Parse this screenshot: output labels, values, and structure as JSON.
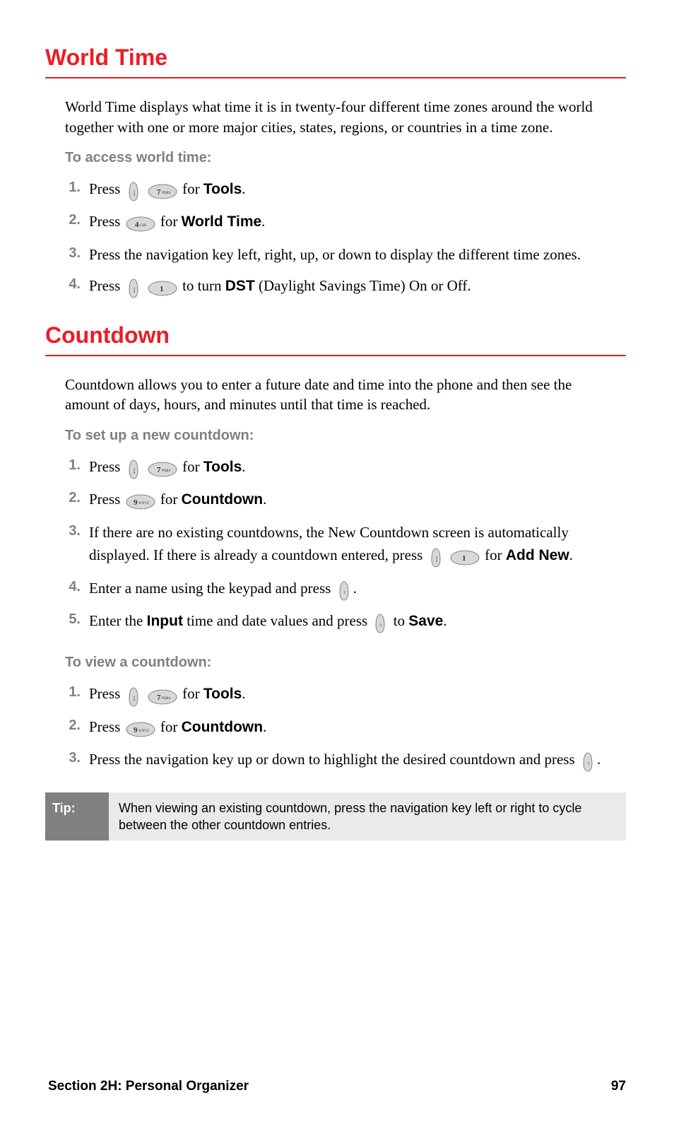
{
  "sections": [
    {
      "heading": "World Time",
      "intro": "World Time displays what time it is in twenty-four different time zones around the world together with one or more major cities, states, regions, or countries in a time zone.",
      "subhead": "To access world time:",
      "steps": [
        {
          "n": "1.",
          "pre": "Press ",
          "icons": [
            "menu",
            "key7"
          ],
          "mid": " for ",
          "bold": "Tools",
          "post": "."
        },
        {
          "n": "2.",
          "pre": "Press ",
          "icons": [
            "key4"
          ],
          "mid": " for ",
          "bold": "World Time",
          "post": "."
        },
        {
          "n": "3.",
          "text": "Press the navigation key left, right, up, or down to display the different time zones."
        },
        {
          "n": "4.",
          "pre": "Press ",
          "icons": [
            "menu",
            "key1"
          ],
          "mid": " to turn ",
          "bold": "DST",
          "post": " (Daylight Savings Time) On or Off."
        }
      ]
    },
    {
      "heading": "Countdown",
      "intro": "Countdown allows you to enter a future date and time into the phone and then see the amount of days, hours, and minutes until that time is reached.",
      "subheads": [
        "To set up a new countdown:",
        "To view a countdown:"
      ],
      "setup_steps": [
        {
          "n": "1.",
          "pre": "Press ",
          "icons": [
            "menu",
            "key7"
          ],
          "mid": " for ",
          "bold": "Tools",
          "post": "."
        },
        {
          "n": "2.",
          "pre": "Press ",
          "icons": [
            "key9"
          ],
          "mid": " for ",
          "bold": "Countdown",
          "post": "."
        },
        {
          "n": "3.",
          "text_pre": "If there are no existing countdowns, the New Countdown screen is automatically displayed. If there is already a countdown entered, press ",
          "icons": [
            "menu",
            "key1"
          ],
          "mid": " for ",
          "bold": "Add New",
          "post": "."
        },
        {
          "n": "4.",
          "pre": "Enter a name using the keypad and press ",
          "icons": [
            "ok"
          ],
          "post": "."
        },
        {
          "n": "5.",
          "pre": "Enter the ",
          "bold1": "Input",
          "mid1": " time and date values and press ",
          "icons": [
            "ok"
          ],
          "mid": " to ",
          "bold": "Save",
          "post": "."
        }
      ],
      "view_steps": [
        {
          "n": "1.",
          "pre": "Press ",
          "icons": [
            "menu",
            "key7"
          ],
          "mid": " for ",
          "bold": "Tools",
          "post": "."
        },
        {
          "n": "2.",
          "pre": "Press ",
          "icons": [
            "key9"
          ],
          "mid": " for ",
          "bold": "Countdown",
          "post": "."
        },
        {
          "n": "3.",
          "pre": "Press the navigation key up or down to highlight the desired countdown and press ",
          "icons": [
            "ok"
          ],
          "post": "."
        }
      ]
    }
  ],
  "tip": {
    "label": "Tip:",
    "text": "When viewing an existing countdown, press the navigation key left or right to cycle between the other countdown entries."
  },
  "footer": {
    "section": "Section 2H: Personal Organizer",
    "page": "97"
  },
  "key_labels": {
    "key7": "7PQRS",
    "key4": "4GHI",
    "key1": "1",
    "key9": "9WXYZ",
    "menu": "MENU",
    "ok": "OK"
  }
}
